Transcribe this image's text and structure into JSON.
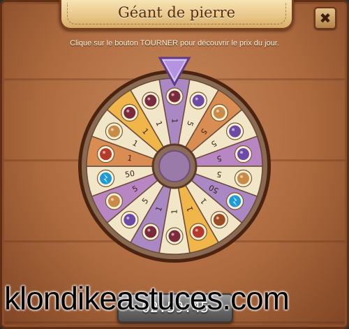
{
  "window": {
    "title": "Géant de pierre",
    "close_label": "✖",
    "close_icon": "close-icon"
  },
  "instruction": "Clique sur le bouton TOURNER pour découvrir le prix du jour.",
  "pointer_icon": "pointer-arrow-icon",
  "wheel": {
    "segments": [
      {
        "prize": "berry-basket",
        "quantity": "1",
        "color": "#a988c4"
      },
      {
        "prize": "blueberry-pie",
        "quantity": "5",
        "color": "#f1e6c8"
      },
      {
        "prize": "cookie",
        "quantity": "5",
        "color": "#d98d52"
      },
      {
        "prize": "blueberry-pie",
        "quantity": "5",
        "color": "#f1e6c8"
      },
      {
        "prize": "blueberry-pie",
        "quantity": "5",
        "color": "#b886c2"
      },
      {
        "prize": "cookie",
        "quantity": "5",
        "color": "#f1e6c8"
      },
      {
        "prize": "energy",
        "quantity": "50",
        "color": "#a988c4"
      },
      {
        "prize": "meat-pie",
        "quantity": "1",
        "color": "#f1e6c8"
      },
      {
        "prize": "cherry-pie",
        "quantity": "1",
        "color": "#f0b649"
      },
      {
        "prize": "berry-basket",
        "quantity": "1",
        "color": "#f1e6c8"
      },
      {
        "prize": "berry-basket",
        "quantity": "1",
        "color": "#a988c4"
      },
      {
        "prize": "blueberry-pie",
        "quantity": "5",
        "color": "#f1e6c8"
      },
      {
        "prize": "cookie",
        "quantity": "5",
        "color": "#b886c2"
      },
      {
        "prize": "energy",
        "quantity": "50",
        "color": "#f1e6c8"
      },
      {
        "prize": "cherry-pie",
        "quantity": "1",
        "color": "#d98d52"
      },
      {
        "prize": "cookie",
        "quantity": "1",
        "color": "#f1e6c8"
      },
      {
        "prize": "berry-basket",
        "quantity": "1",
        "color": "#f0b649"
      },
      {
        "prize": "berry-basket",
        "quantity": "1",
        "color": "#f1e6c8"
      }
    ]
  },
  "timer": "02:59:45",
  "watermark": "klondikeastuces.com"
}
